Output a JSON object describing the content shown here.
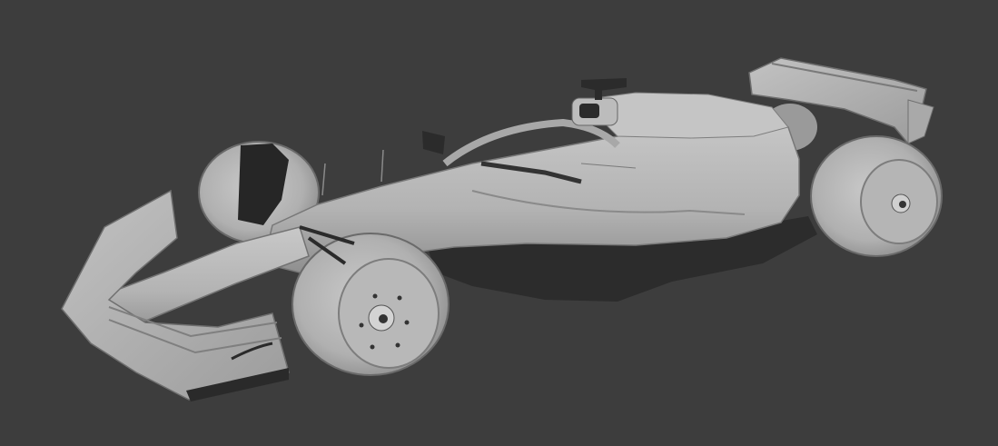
{
  "viewport": {
    "background": "#3d3d3d",
    "shading_mode": "solid",
    "model": {
      "subject": "formula-one-car",
      "clay_color": "#b8b8b8",
      "dark_part_color": "#2a2a2a"
    }
  }
}
